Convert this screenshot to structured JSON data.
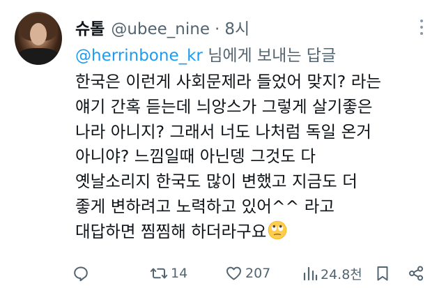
{
  "tweet": {
    "display_name": "슈톨",
    "handle": "@ubee_nine",
    "separator": "·",
    "time": "8시",
    "reply_to": {
      "mention": "@herrinbone_kr",
      "suffix": " 님에게 보내는 답글"
    },
    "body_lines": [
      "한국은 이런게 사회문제라 들었어 맞지? 라는",
      "얘기 간혹 듣는데 늬앙스가 그렇게 살기좋은",
      "나라 아니지? 그래서 너도 나처럼 독일 온거",
      "아니야? 느낌일때 아닌뎅 그것도 다",
      "옛날소리지 한국도 많이 변했고 지금도 더",
      "좋게 변하려고 노력하고 있어^^ 라고",
      "대답하면 찜찜해 하더라구요"
    ],
    "body_emoji": "face-with-rolling-eyes"
  },
  "actions": {
    "reply_icon": "reply-icon",
    "retweet_icon": "retweet-icon",
    "retweet_count": "14",
    "like_icon": "heart-icon",
    "like_count": "207",
    "views_icon": "views-icon",
    "views_count": "24.8천",
    "bookmark_icon": "bookmark-icon",
    "share_icon": "share-icon"
  },
  "colors": {
    "text": "#0f1419",
    "secondary": "#536471",
    "link": "#1d9bf0",
    "background": "#ffffff"
  }
}
